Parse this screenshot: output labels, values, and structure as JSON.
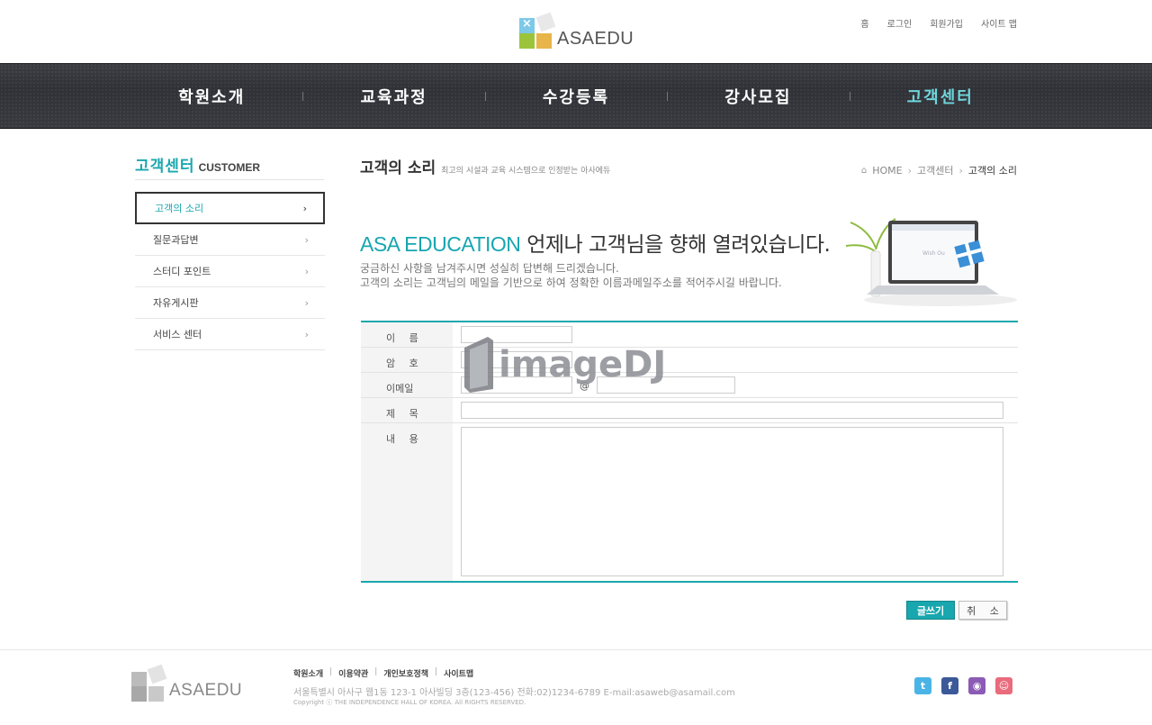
{
  "brand": {
    "logo_text": "ASAEDU"
  },
  "top_links": [
    "홈",
    "로그인",
    "회원가입",
    "사이트 맵"
  ],
  "main_nav": [
    "학원소개",
    "교육과정",
    "수강등록",
    "강사모집",
    "고객센터"
  ],
  "sidebar": {
    "title_ko": "고객센터",
    "title_en": "CUSTOMER",
    "items": [
      "고객의 소리",
      "질문과답변",
      "스터디 포인트",
      "자유게시판",
      "서비스 센터"
    ],
    "chevron": "›"
  },
  "page": {
    "title": "고객의 소리",
    "subtitle": "최고의 시설과 교육 시스템으로 인정받는 아사에듀",
    "breadcrumb": [
      "HOME",
      "고객센터",
      "고객의 소리"
    ],
    "breadcrumb_sep": "›"
  },
  "intro": {
    "headline_en": "ASA EDUCATION",
    "headline_ko": " 언제나 고객님을 향해 열려있습니다.",
    "line1": "궁금하신 사항을 남겨주시면 성실히 답변해 드리겠습니다.",
    "line2": "고객의 소리는 고객님의 메일을 기반으로 하여 정확한 이름과메일주소를 적어주시길 바랍니다.",
    "screen_text": "Wish Ou"
  },
  "form": {
    "name_label": "이 름",
    "password_label": "암 호",
    "email_label": "이메일",
    "email_at": "@",
    "subject_label": "제 목",
    "content_label": "내 용",
    "name_value": "",
    "password_value": "",
    "email_user_value": "",
    "email_domain_value": "",
    "subject_value": "",
    "content_value": ""
  },
  "buttons": {
    "submit": "글쓰기",
    "cancel": "취 소"
  },
  "watermark": {
    "text": "imageDJ"
  },
  "footer": {
    "links": [
      "학원소개",
      "이용약관",
      "개인보호정책",
      "사이트맵"
    ],
    "link_divider": "|",
    "address": "서울특별시 아사구 웹1동 123-1 아사빌딩 3층(123-456) 전화:02)1234-6789 E-mail:asaweb@asamail.com",
    "copyright": "Copyright ⓒ THE INDEPENDENCE HALL OF KOREA. All RIGHTS RESERVED.",
    "social": [
      "twitter",
      "facebook",
      "podcast",
      "blog"
    ]
  },
  "colors": {
    "accent": "#1aa7ae",
    "nav_bg": "#33353a",
    "nav_active": "#6fd6dc"
  }
}
